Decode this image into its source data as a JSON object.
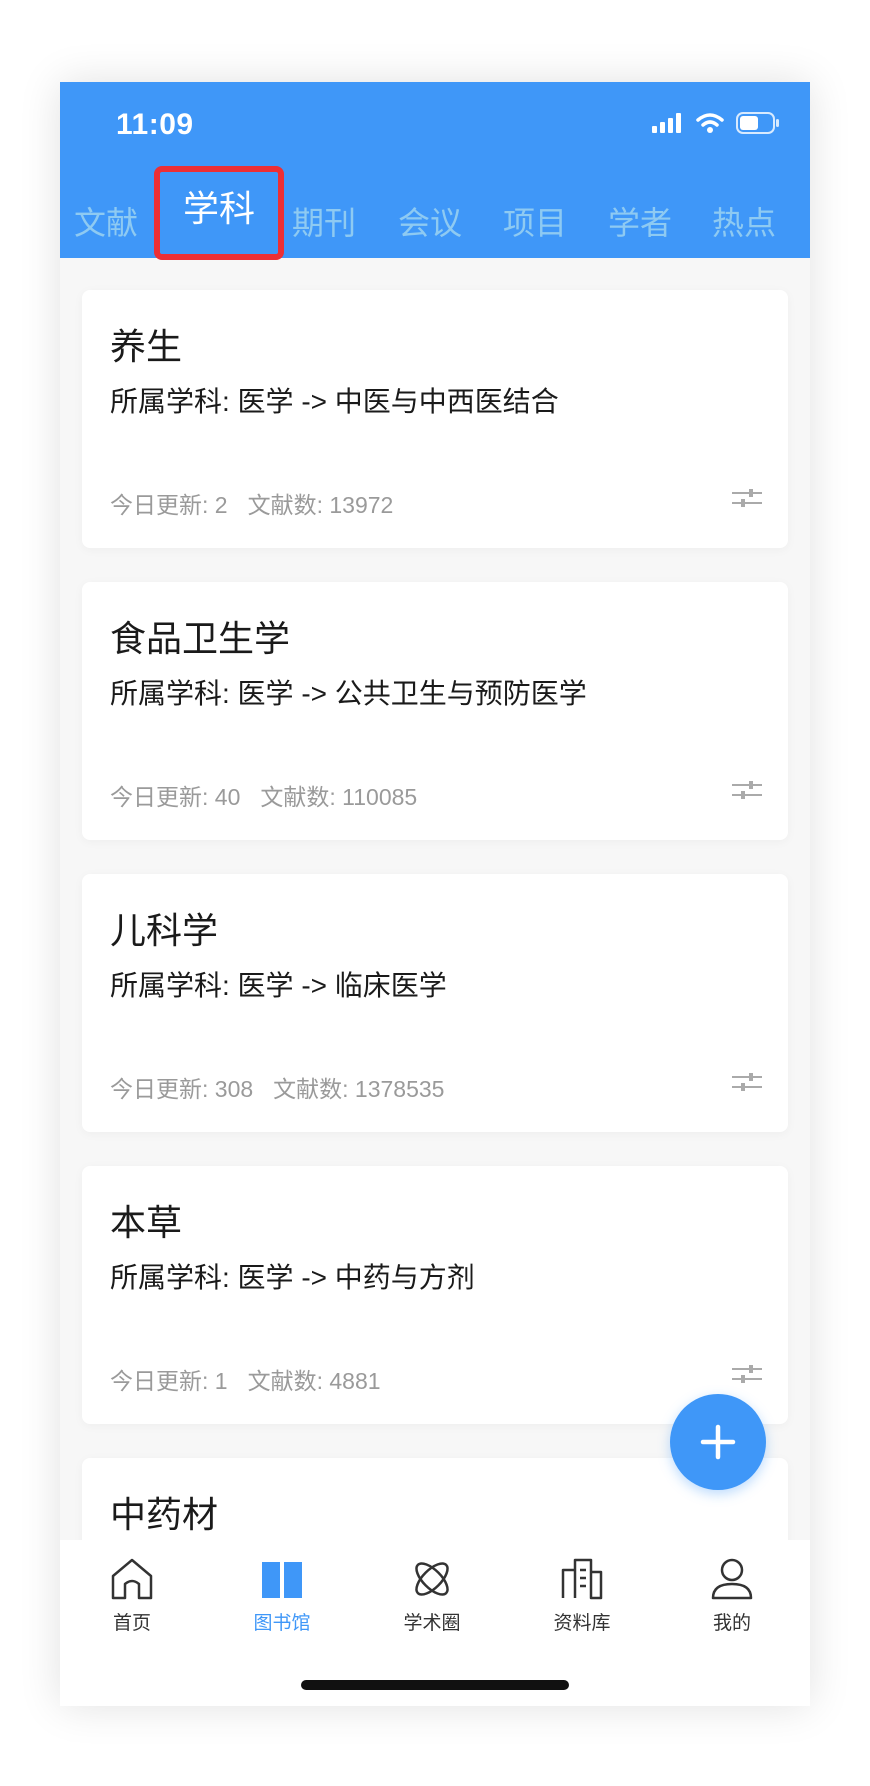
{
  "status_bar": {
    "time": "11:09"
  },
  "tabs": [
    {
      "label": "文献"
    },
    {
      "label": "学科"
    },
    {
      "label": "期刊"
    },
    {
      "label": "会议"
    },
    {
      "label": "项目"
    },
    {
      "label": "学者"
    },
    {
      "label": "热点"
    }
  ],
  "active_tab": "学科",
  "cards": [
    {
      "title": "养生",
      "subject": "所属学科: 医学 -> 中医与中西医结合",
      "today_update": "今日更新: 2",
      "doc_count": "文献数: 13972"
    },
    {
      "title": "食品卫生学",
      "subject": "所属学科: 医学 -> 公共卫生与预防医学",
      "today_update": "今日更新: 40",
      "doc_count": "文献数: 110085"
    },
    {
      "title": "儿科学",
      "subject": "所属学科: 医学 -> 临床医学",
      "today_update": "今日更新: 308",
      "doc_count": "文献数: 1378535"
    },
    {
      "title": "本草",
      "subject": "所属学科: 医学 -> 中药与方剂",
      "today_update": "今日更新: 1",
      "doc_count": "文献数: 4881"
    },
    {
      "title": "中药材",
      "subject": "",
      "today_update": "",
      "doc_count": ""
    }
  ],
  "bottom_nav": [
    {
      "label": "首页",
      "icon": "home-icon"
    },
    {
      "label": "图书馆",
      "icon": "book-icon"
    },
    {
      "label": "学术圈",
      "icon": "atom-icon"
    },
    {
      "label": "资料库",
      "icon": "building-icon"
    },
    {
      "label": "我的",
      "icon": "user-icon"
    }
  ],
  "colors": {
    "primary": "#3f97f8",
    "highlight_border": "#ec2f35",
    "inactive_tab": "#8ecaf2"
  }
}
